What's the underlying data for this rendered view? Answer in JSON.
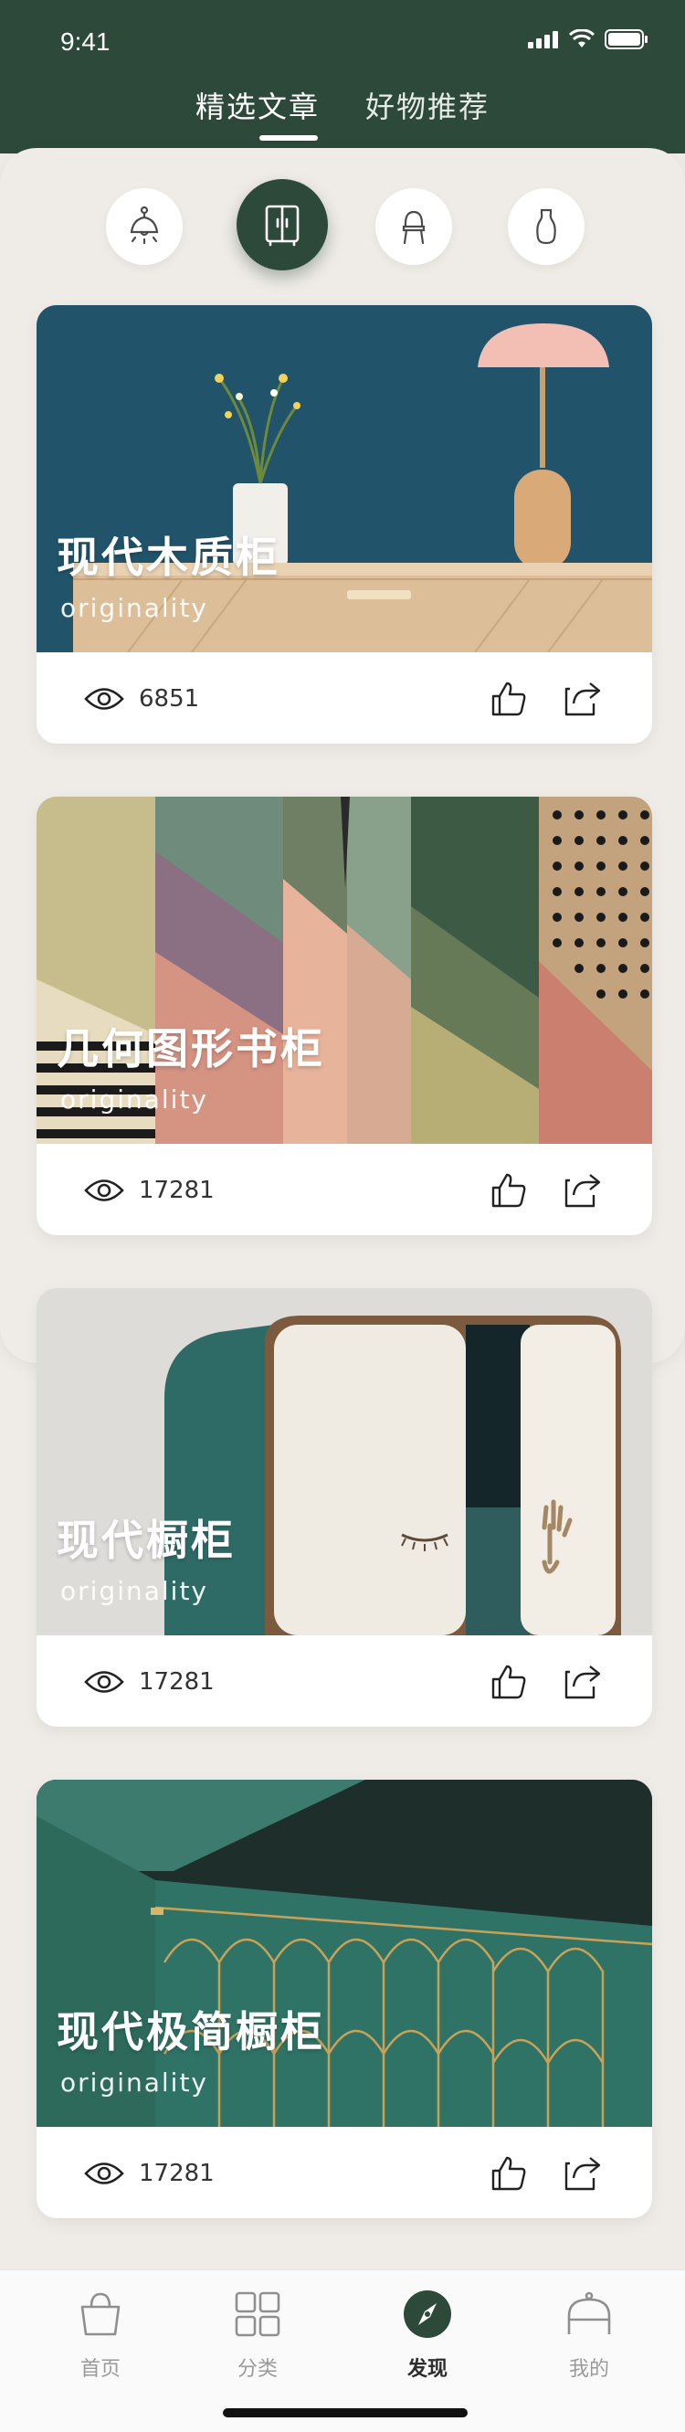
{
  "status": {
    "time": "9:41"
  },
  "tabs": [
    {
      "label": "精选文章",
      "active": true
    },
    {
      "label": "好物推荐",
      "active": false
    }
  ],
  "categories": [
    {
      "icon": "lamp-icon",
      "active": false
    },
    {
      "icon": "cabinet-icon",
      "active": true
    },
    {
      "icon": "chair-icon",
      "active": false
    },
    {
      "icon": "vase-icon",
      "active": false
    }
  ],
  "articles": [
    {
      "title": "现代木质柜",
      "subtitle": "originality",
      "views": "6851"
    },
    {
      "title": "几何图形书柜",
      "subtitle": "originality",
      "views": "17281"
    },
    {
      "title": "现代橱柜",
      "subtitle": "originality",
      "views": "17281"
    },
    {
      "title": "现代极简橱柜",
      "subtitle": "originality",
      "views": "17281"
    }
  ],
  "nav": [
    {
      "label": "首页",
      "icon": "bag-icon",
      "active": false
    },
    {
      "label": "分类",
      "icon": "grid-icon",
      "active": false
    },
    {
      "label": "发现",
      "icon": "compass-icon",
      "active": true
    },
    {
      "label": "我的",
      "icon": "user-icon",
      "active": false
    }
  ],
  "colors": {
    "brand": "#2d4939",
    "background": "#efebe7"
  }
}
